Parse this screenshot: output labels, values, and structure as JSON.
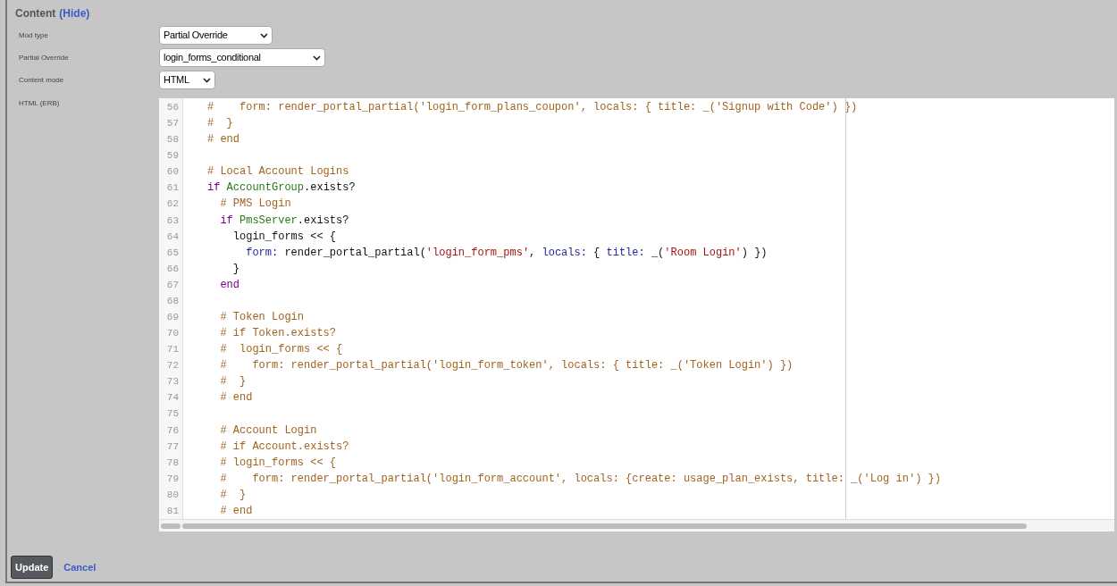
{
  "section": {
    "title": "Content",
    "toggle_link": "(Hide)"
  },
  "fields": [
    {
      "label": "Mod type",
      "value": "Partial Override"
    },
    {
      "label": "Partial Override",
      "value": "login_forms_conditional"
    },
    {
      "label": "Content mode",
      "value": "HTML"
    }
  ],
  "editor": {
    "label": "HTML (ERB)",
    "lines": [
      {
        "number": "56",
        "tokens": [
          {
            "kind": "comment",
            "text": "#    form: render_portal_partial('login_form_plans_coupon', locals: { title: _('Signup with Code') })"
          }
        ]
      },
      {
        "number": "57",
        "tokens": [
          {
            "kind": "comment",
            "text": "#  }"
          }
        ]
      },
      {
        "number": "58",
        "tokens": [
          {
            "kind": "comment",
            "text": "# end"
          }
        ]
      },
      {
        "number": "59"
      },
      {
        "number": "60",
        "tokens": [
          {
            "kind": "comment",
            "text": "# Local Account Logins"
          }
        ]
      },
      {
        "number": "61",
        "tokens": [
          {
            "kind": "keyword",
            "text": "if"
          },
          {
            "kind": "constant",
            "text": " AccountGroup"
          },
          {
            "kind": "plain",
            "text": ".exists?"
          }
        ]
      },
      {
        "number": "62",
        "tokens": [
          {
            "kind": "comment",
            "text": "  # PMS Login"
          }
        ]
      },
      {
        "number": "63",
        "tokens": [
          {
            "kind": "keyword",
            "text": "  if"
          },
          {
            "kind": "constant",
            "text": " PmsServer"
          },
          {
            "kind": "plain",
            "text": ".exists?"
          }
        ]
      },
      {
        "number": "64",
        "tokens": [
          {
            "kind": "plain",
            "text": "    login_forms << {"
          }
        ]
      },
      {
        "number": "65",
        "tokens": [
          {
            "kind": "symbol",
            "text": "      form:"
          },
          {
            "kind": "plain",
            "text": " render_portal_partial("
          },
          {
            "kind": "string",
            "text": "'login_form_pms'"
          },
          {
            "kind": "plain",
            "text": ","
          },
          {
            "kind": "symbol",
            "text": " locals:"
          },
          {
            "kind": "plain",
            "text": " {"
          },
          {
            "kind": "symbol",
            "text": " title:"
          },
          {
            "kind": "plain",
            "text": " _("
          },
          {
            "kind": "string",
            "text": "'Room Login'"
          },
          {
            "kind": "plain",
            "text": ") })"
          }
        ]
      },
      {
        "number": "66",
        "tokens": [
          {
            "kind": "plain",
            "text": "    }"
          }
        ]
      },
      {
        "number": "67",
        "tokens": [
          {
            "kind": "keyword",
            "text": "  end"
          }
        ]
      },
      {
        "number": "68"
      },
      {
        "number": "69",
        "tokens": [
          {
            "kind": "comment",
            "text": "  # Token Login"
          }
        ]
      },
      {
        "number": "70",
        "tokens": [
          {
            "kind": "comment",
            "text": "  # if Token.exists?"
          }
        ]
      },
      {
        "number": "71",
        "tokens": [
          {
            "kind": "comment",
            "text": "  #  login_forms << {"
          }
        ]
      },
      {
        "number": "72",
        "tokens": [
          {
            "kind": "comment",
            "text": "  #    form: render_portal_partial('login_form_token', locals: { title: _('Token Login') })"
          }
        ]
      },
      {
        "number": "73",
        "tokens": [
          {
            "kind": "comment",
            "text": "  #  }"
          }
        ]
      },
      {
        "number": "74",
        "tokens": [
          {
            "kind": "comment",
            "text": "  # end"
          }
        ]
      },
      {
        "number": "75"
      },
      {
        "number": "76",
        "tokens": [
          {
            "kind": "comment",
            "text": "  # Account Login"
          }
        ]
      },
      {
        "number": "77",
        "tokens": [
          {
            "kind": "comment",
            "text": "  # if Account.exists?"
          }
        ]
      },
      {
        "number": "78",
        "tokens": [
          {
            "kind": "comment",
            "text": "  # login_forms << {"
          }
        ]
      },
      {
        "number": "79",
        "tokens": [
          {
            "kind": "comment",
            "text": "  #    form: render_portal_partial('login_form_account', locals: {create: usage_plan_exists, title: _('Log in') })"
          }
        ]
      },
      {
        "number": "80",
        "tokens": [
          {
            "kind": "comment",
            "text": "  #  }"
          }
        ]
      },
      {
        "number": "81",
        "tokens": [
          {
            "kind": "comment",
            "text": "  # end"
          }
        ]
      }
    ]
  },
  "actions": {
    "submit": "Update",
    "cancel": "Cancel"
  }
}
